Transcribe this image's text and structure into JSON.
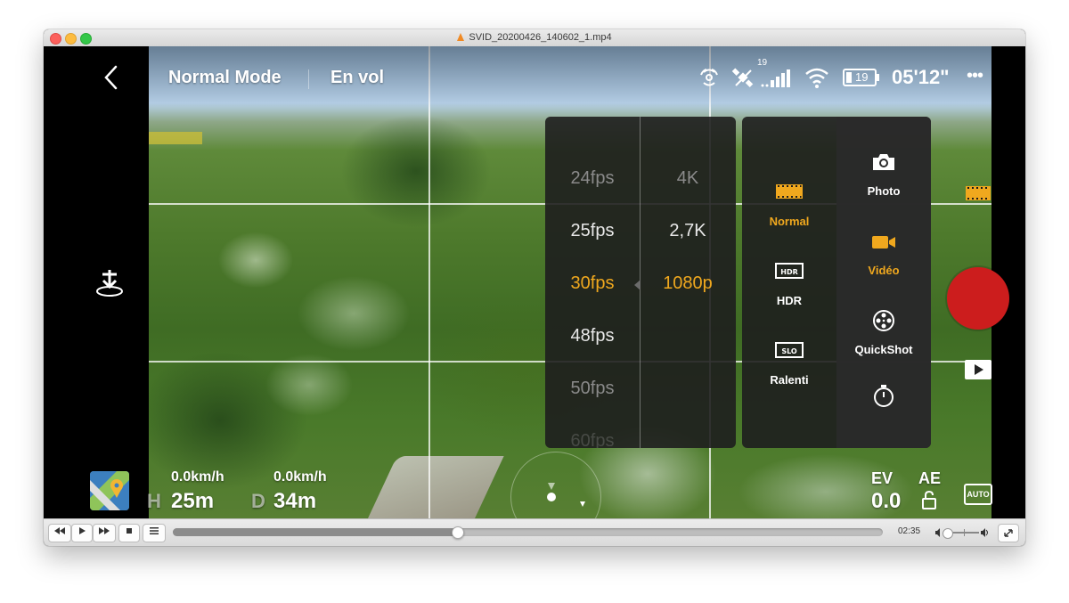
{
  "window": {
    "title": "SVID_20200426_140602_1.mp4"
  },
  "hud": {
    "mode_label": "Normal Mode",
    "flight_status": "En vol",
    "satellite_count": "19",
    "battery_level": "19",
    "flight_time": "05'12\"",
    "more_label": "•••"
  },
  "settings_panel": {
    "framerates": [
      {
        "label": "24fps",
        "state": "dim"
      },
      {
        "label": "25fps",
        "state": "norm"
      },
      {
        "label": "30fps",
        "state": "sel"
      },
      {
        "label": "48fps",
        "state": "norm"
      },
      {
        "label": "50fps",
        "state": "dim"
      },
      {
        "label": "60fps",
        "state": "faded"
      }
    ],
    "resolutions": [
      {
        "label": "4K",
        "state": "dim"
      },
      {
        "label": "2,7K",
        "state": "norm"
      },
      {
        "label": "1080p",
        "state": "sel"
      }
    ],
    "video_submodes": [
      {
        "label": "Normal",
        "selected": true
      },
      {
        "label": "HDR",
        "selected": false
      },
      {
        "label": "Ralenti",
        "selected": false
      }
    ],
    "camera_modes": [
      {
        "label": "Photo",
        "selected": false
      },
      {
        "label": "Vidéo",
        "selected": true
      },
      {
        "label": "QuickShot",
        "selected": false
      },
      {
        "label": "",
        "selected": false
      }
    ]
  },
  "telemetry": {
    "h_speed": "0.0km/h",
    "v_speed": "0.0km/h",
    "height_label": "H",
    "height": "25m",
    "distance_label": "D",
    "distance": "34m",
    "ev_label": "EV",
    "ev_value": "0.0",
    "ae_label": "AE",
    "auto_label": "AUTO"
  },
  "player": {
    "current_time": "02:35",
    "progress_fraction": 0.4,
    "volume_fraction": 0.1
  },
  "colors": {
    "accent": "#f0a81e",
    "record": "#cc1d1d"
  }
}
